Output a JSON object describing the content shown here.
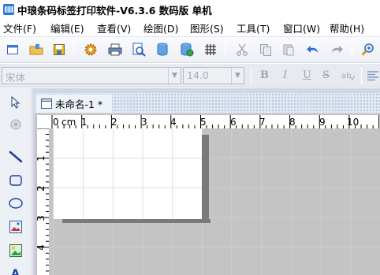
{
  "window": {
    "title": "中琅条码标签打印软件-V6.3.6 数码版 单机"
  },
  "menu": [
    {
      "label": "文件(F)"
    },
    {
      "label": "编辑(E)"
    },
    {
      "label": "查看(V)"
    },
    {
      "label": "绘图(D)"
    },
    {
      "label": "图形(S)"
    },
    {
      "label": "工具(T)"
    },
    {
      "label": "窗口(W)"
    },
    {
      "label": "帮助(H)"
    }
  ],
  "toolbar": {
    "icons": [
      "new-document-icon",
      "open-folder-icon",
      "save-icon",
      "settings-gear-icon",
      "print-icon",
      "print-preview-icon",
      "database-icon",
      "database-settings-icon",
      "grid-icon",
      "cut-icon",
      "copy-icon",
      "paste-icon",
      "undo-icon",
      "redo-icon",
      "zoom-in-icon"
    ]
  },
  "format": {
    "font_name": "宋体",
    "font_size": "14.0",
    "bold": "B",
    "italic": "I",
    "underline": "U",
    "strikethrough": "S"
  },
  "document": {
    "tab_title": "未命名-1 *",
    "ruler_unit": "cm",
    "ruler_top_labels": [
      "0",
      "1",
      "2",
      "3",
      "4",
      "5",
      "6",
      "7",
      "8",
      "9",
      "10"
    ],
    "ruler_left_labels": [
      "1",
      "2",
      "3",
      "4",
      "5"
    ]
  },
  "colors": {
    "accent": "#1f5fbf",
    "canvas_background": "#c4c4c4",
    "label_page": "#ffffff"
  }
}
